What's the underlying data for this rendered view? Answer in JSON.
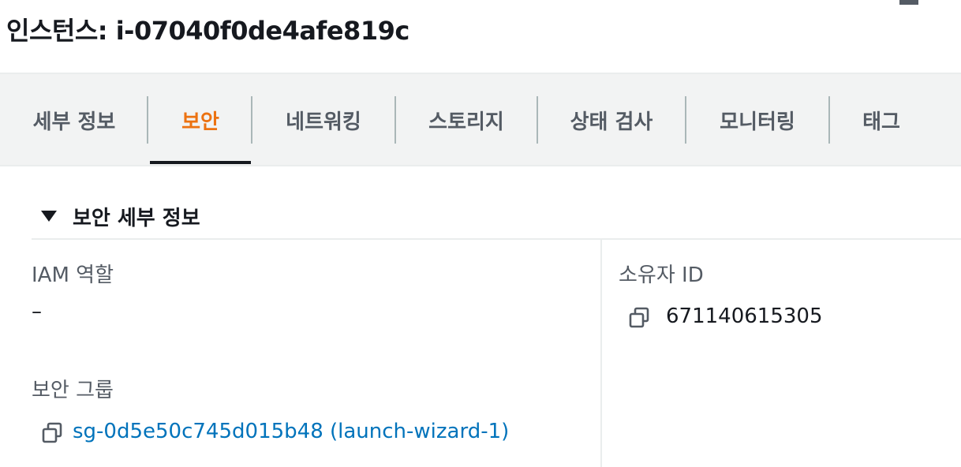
{
  "header": {
    "title": "인스턴스: i-07040f0de4afe819c"
  },
  "tabs": [
    {
      "label": "세부 정보",
      "active": false
    },
    {
      "label": "보안",
      "active": true
    },
    {
      "label": "네트워킹",
      "active": false
    },
    {
      "label": "스토리지",
      "active": false
    },
    {
      "label": "상태 검사",
      "active": false
    },
    {
      "label": "모니터링",
      "active": false
    },
    {
      "label": "태그",
      "active": false
    }
  ],
  "security_details": {
    "title": "보안 세부 정보",
    "iam_role": {
      "label": "IAM 역할",
      "value": "–"
    },
    "owner_id": {
      "label": "소유자 ID",
      "value": "671140615305"
    },
    "security_groups": {
      "label": "보안 그룹",
      "items": [
        "sg-0d5e50c745d015b48 (launch-wizard-1)"
      ]
    }
  },
  "colors": {
    "active_tab": "#ec7211",
    "link": "#0073bb",
    "text": "#16191f",
    "muted": "#545b64",
    "tabbar_bg": "#f2f3f3"
  },
  "icons": [
    "copy-icon",
    "caret-down-icon"
  ]
}
